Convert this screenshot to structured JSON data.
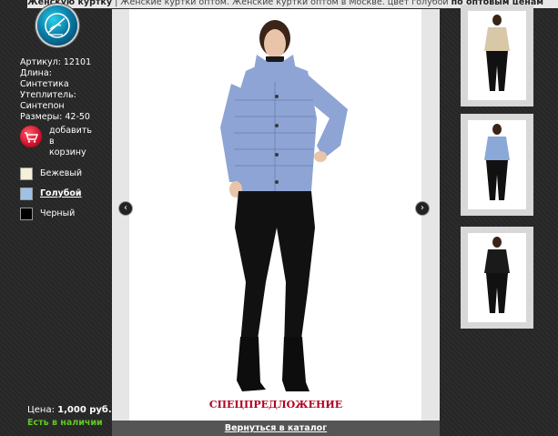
{
  "header": {
    "title_lead": "Женскую куртку",
    "title_rest": " | Женские куртки оптом. Женские куртки оптом в Москве. цвет голубой ",
    "title_tail": "по оптовым ценам"
  },
  "product": {
    "article": "Артикул: 12101",
    "length_label": "Длина:",
    "length_value": "Синтетика",
    "insulation_label": "Утеплитель:",
    "insulation_value": "Синтепон",
    "sizes": "Размеры: 42-50",
    "cart_line1": "добавить",
    "cart_line2": "в",
    "cart_line3": "корзину"
  },
  "colors": [
    {
      "label": "Бежевый",
      "hex": "#f5f0d8",
      "selected": false
    },
    {
      "label": "Голубой",
      "hex": "#9ec2e6",
      "selected": true
    },
    {
      "label": "Черный",
      "hex": "#000000",
      "selected": false
    }
  ],
  "price": {
    "label": "Цена:",
    "value": "1,000 руб."
  },
  "stock": "Есть в наличии",
  "viewer": {
    "special_offer": "СПЕЦПРЕДЛОЖЕНИЕ",
    "back_link": "Вернуться в каталог",
    "prev_icon": "chevron-left-icon",
    "next_icon": "chevron-right-icon"
  },
  "thumbnails": [
    {
      "jacket_color": "#d8c8a8"
    },
    {
      "jacket_color": "#8aa8d8"
    },
    {
      "jacket_color": "#1a1a1a"
    }
  ],
  "model": {
    "jacket_color": "#8ea4d4",
    "pants_color": "#111111",
    "skin_color": "#e8c4a8",
    "hair_color": "#3a2418"
  }
}
